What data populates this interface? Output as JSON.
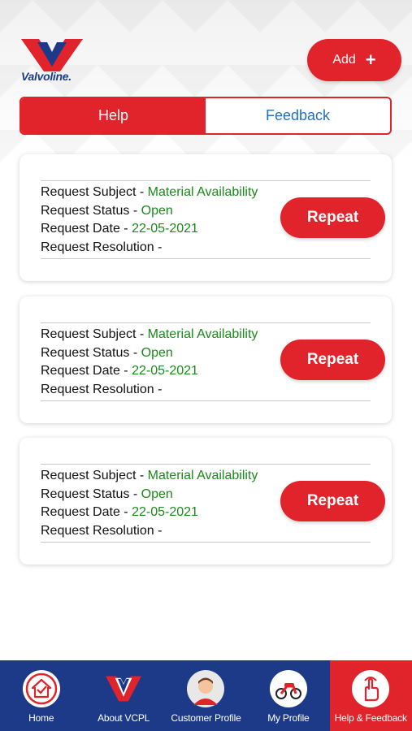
{
  "brand": {
    "name": "Valvoline.",
    "red": "#e1232c",
    "blue": "#1c3a88"
  },
  "header": {
    "add_label": "Add",
    "add_icon": "plus-icon"
  },
  "tabs": [
    {
      "label": "Help",
      "active": true
    },
    {
      "label": "Feedback",
      "active": false
    }
  ],
  "requests": [
    {
      "subject_label": "Request Subject - ",
      "subject": "Material Availability",
      "status_label": "Request Status - ",
      "status": "Open",
      "date_label": "Request Date - ",
      "date": "22-05-2021",
      "resolution_label": "Request Resolution -",
      "resolution": "",
      "action": "Repeat"
    },
    {
      "subject_label": "Request Subject - ",
      "subject": "Material Availability",
      "status_label": "Request Status - ",
      "status": "Open",
      "date_label": "Request Date - ",
      "date": "22-05-2021",
      "resolution_label": "Request Resolution -",
      "resolution": "",
      "action": "Repeat"
    },
    {
      "subject_label": "Request Subject - ",
      "subject": "Material Availability",
      "status_label": "Request Status - ",
      "status": "Open",
      "date_label": "Request Date - ",
      "date": "22-05-2021",
      "resolution_label": "Request Resolution -",
      "resolution": "",
      "action": "Repeat"
    }
  ],
  "bottom_nav": [
    {
      "label": "Home",
      "icon": "home-icon",
      "active": false
    },
    {
      "label": "About VCPL",
      "icon": "valvoline-logo-icon",
      "active": false
    },
    {
      "label": "Customer Profile",
      "icon": "customer-avatar-icon",
      "active": false
    },
    {
      "label": "My Profile",
      "icon": "motorbike-icon",
      "active": false
    },
    {
      "label": "Help & Feedback",
      "icon": "hand-tap-icon",
      "active": true
    }
  ]
}
